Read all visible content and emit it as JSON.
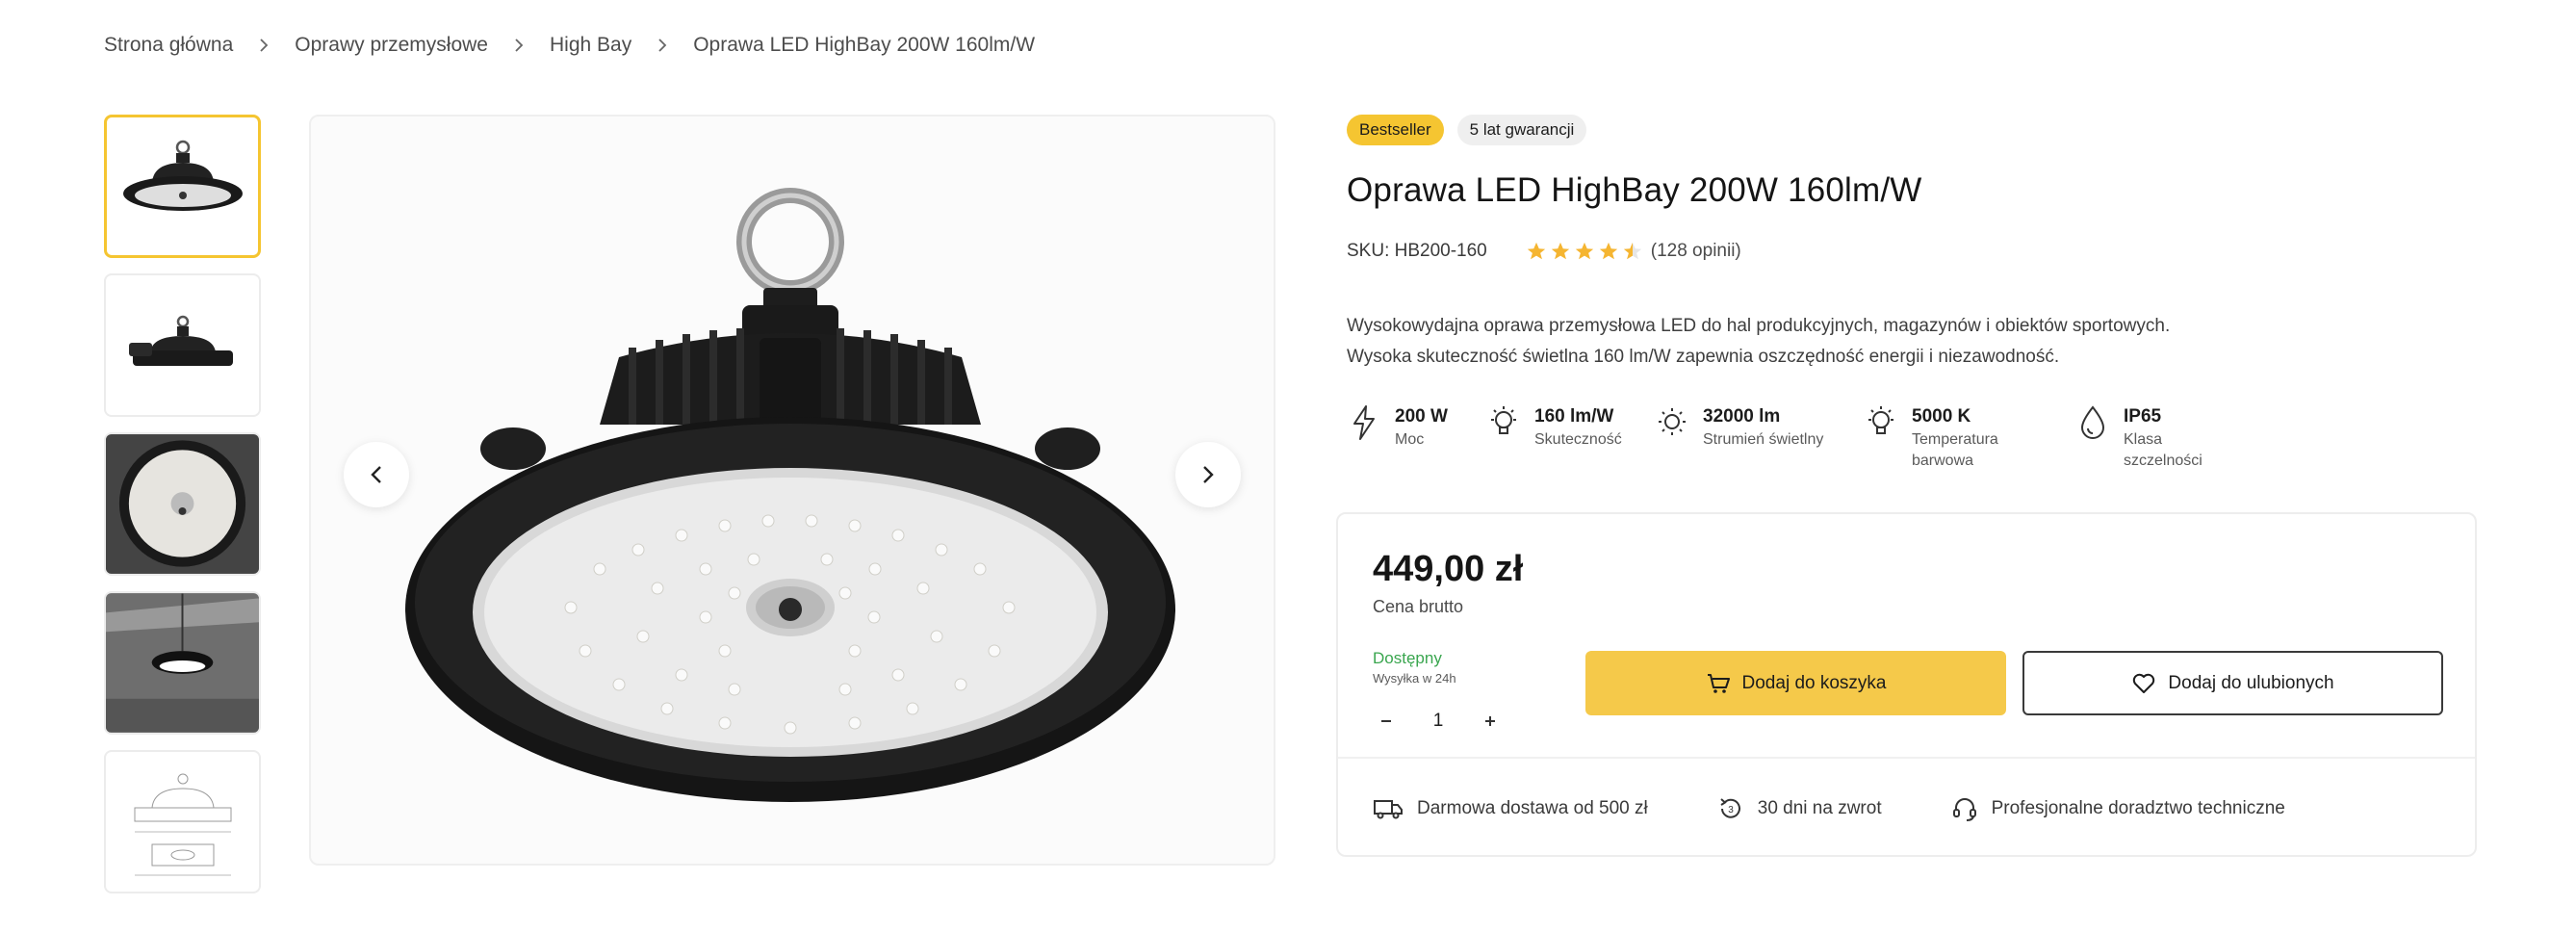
{
  "breadcrumb": {
    "items": [
      "Strona główna",
      "Oprawy przemysłowe",
      "High Bay",
      "Oprawa LED HighBay 200W 160lm/W"
    ]
  },
  "badges": {
    "bestseller": "Bestseller",
    "warranty": "5 lat gwarancji"
  },
  "product": {
    "title": "Oprawa LED HighBay 200W 160lm/W",
    "sku": "SKU: HB200-160",
    "rating": 4.5,
    "reviews": "(128 opinii)",
    "description_line1": "Wysokowydajna oprawa przemysłowa LED do hal produkcyjnych, magazynów i obiektów sportowych.",
    "description_line2": "Wysoka skuteczność świetlna 160 lm/W zapewnia oszczędność energii i niezawodność."
  },
  "specs": [
    {
      "value": "200 W",
      "label": "Moc",
      "icon": "lightning-icon"
    },
    {
      "value": "160 lm/W",
      "label": "Skuteczność",
      "icon": "bulb-icon"
    },
    {
      "value": "32000 lm",
      "label": "Strumień świetlny",
      "icon": "sun-icon"
    },
    {
      "value": "5000 K",
      "label_line1": "Temperatura",
      "label_line2": "barwowa",
      "icon": "bulb-icon"
    },
    {
      "value": "IP65",
      "label_line1": "Klasa",
      "label_line2": "szczelności",
      "icon": "water-drop-icon"
    }
  ],
  "buy_box": {
    "price": "449,00 zł",
    "price_label": "Cena brutto",
    "stock": "Dostępny",
    "shipping_time": "Wysyłka w 24h",
    "quantity": "1",
    "cart_label": "Dodaj do koszyka",
    "fav_label": "Dodaj do ulubionych"
  },
  "perks": [
    {
      "label": "Darmowa dostawa od 500 zł",
      "icon": "truck-icon"
    },
    {
      "label": "30 dni na zwrot",
      "icon": "return-icon"
    },
    {
      "label": "Profesjonalne doradztwo techniczne",
      "icon": "headset-icon"
    }
  ],
  "colors": {
    "accent": "#f5c531",
    "stock_green": "#3aa64f",
    "text": "#1c1c1c"
  }
}
